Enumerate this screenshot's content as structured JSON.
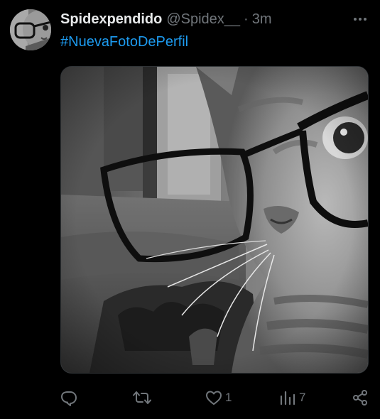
{
  "tweet": {
    "display_name": "Spidexpendido",
    "handle": "@Spidex__",
    "separator": "·",
    "time": "3m",
    "text": "#NuevaFotoDePerfil",
    "avatar_icon": "avatar-cat-glasses",
    "media_icon": "photo-cat-with-glasses"
  },
  "actions": {
    "reply": {
      "icon": "reply-icon",
      "count": ""
    },
    "retweet": {
      "icon": "retweet-icon",
      "count": ""
    },
    "like": {
      "icon": "heart-icon",
      "count": "1"
    },
    "views": {
      "icon": "analytics-icon",
      "count": "7"
    },
    "share": {
      "icon": "share-icon",
      "count": ""
    }
  },
  "colors": {
    "background": "#000000",
    "primary_text": "#e7e9ea",
    "secondary_text": "#71767b",
    "link": "#1d9bf0",
    "border": "#2f3336"
  }
}
